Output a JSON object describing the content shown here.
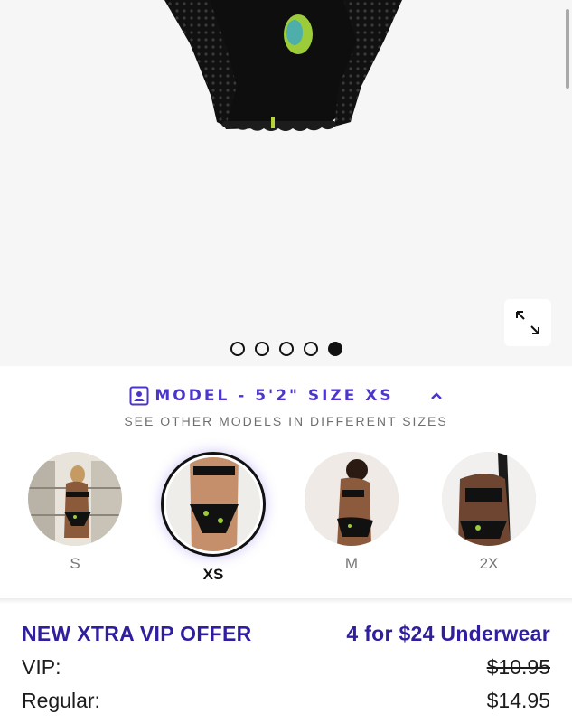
{
  "gallery": {
    "dots_total": 5,
    "active_dot": 5
  },
  "model_selector": {
    "title": "MODEL - 5'2\" SIZE XS",
    "subtitle": "SEE OTHER MODELS IN DIFFERENT SIZES",
    "models": [
      {
        "size": "S",
        "selected": false
      },
      {
        "size": "XS",
        "selected": true
      },
      {
        "size": "M",
        "selected": false
      },
      {
        "size": "2X",
        "selected": false
      }
    ]
  },
  "offer": {
    "title": "NEW XTRA VIP OFFER",
    "deal": "4 for $24 Underwear",
    "vip_label": "VIP:",
    "vip_price": "$10.95",
    "regular_label": "Regular:",
    "regular_price": "$14.95"
  },
  "colors": {
    "accent": "#4a36c9",
    "offer_text": "#2f1f9e",
    "background_gallery": "#f6f6f6"
  }
}
